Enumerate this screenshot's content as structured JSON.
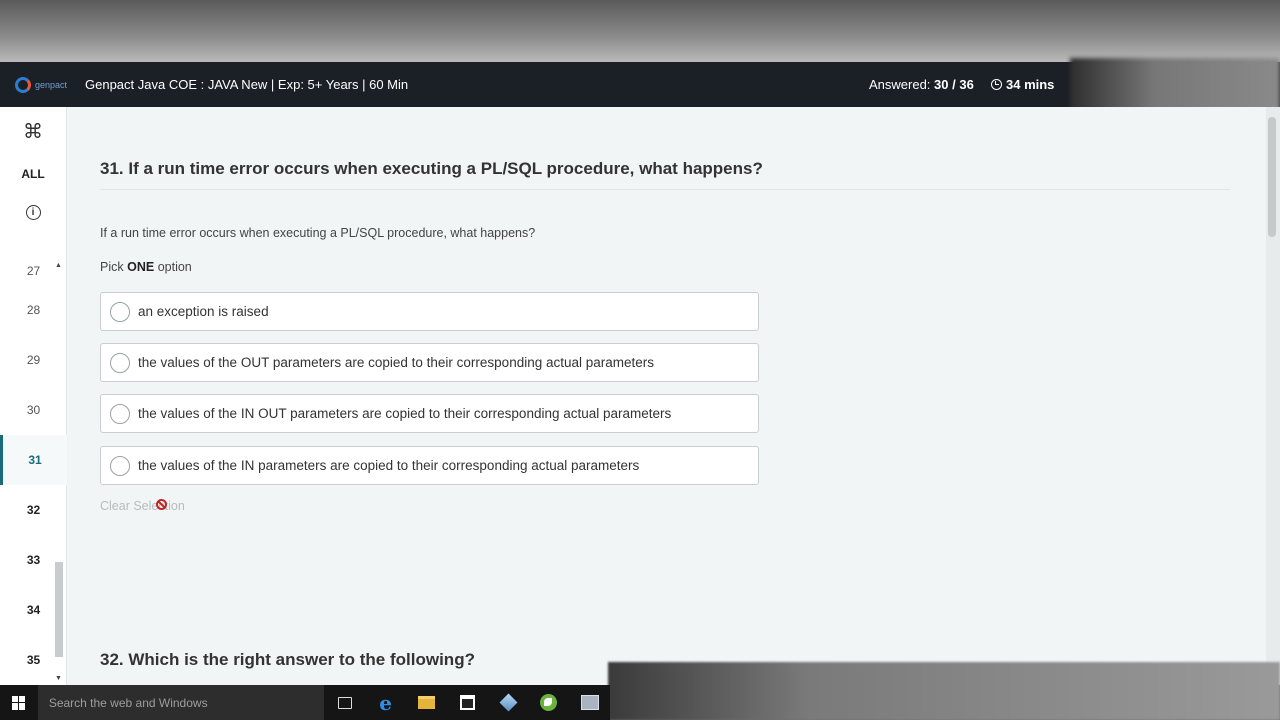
{
  "header": {
    "logo_text": "genpact",
    "exam_title": "Genpact Java COE : JAVA New | Exp: 5+ Years | 60 Min",
    "answered_label": "Answered:",
    "answered_value": "30 / 36",
    "timer": "34 mins"
  },
  "sidebar": {
    "cmd_glyph": "⌘",
    "all_label": "ALL",
    "info_glyph": "i",
    "questions": [
      "27",
      "28",
      "29",
      "30",
      "31",
      "32",
      "33",
      "34",
      "35"
    ],
    "active_question": "31"
  },
  "question": {
    "title": "31. If a run time error occurs when executing a PL/SQL procedure, what happens?",
    "text": "If a run time error occurs when executing a PL/SQL procedure, what happens?",
    "pick_prefix": "Pick",
    "pick_count": "ONE",
    "pick_suffix": "option",
    "options": [
      "an exception is raised",
      "the values of the OUT parameters are copied to their corresponding actual parameters",
      "the values of the IN OUT parameters are copied to their corresponding actual parameters",
      "the values of the IN parameters are copied to their corresponding actual parameters"
    ],
    "clear_label": "Clear Selection"
  },
  "next_question": {
    "title": "32. Which is the right answer to the following?"
  },
  "taskbar": {
    "search_placeholder": "Search the web and Windows"
  }
}
